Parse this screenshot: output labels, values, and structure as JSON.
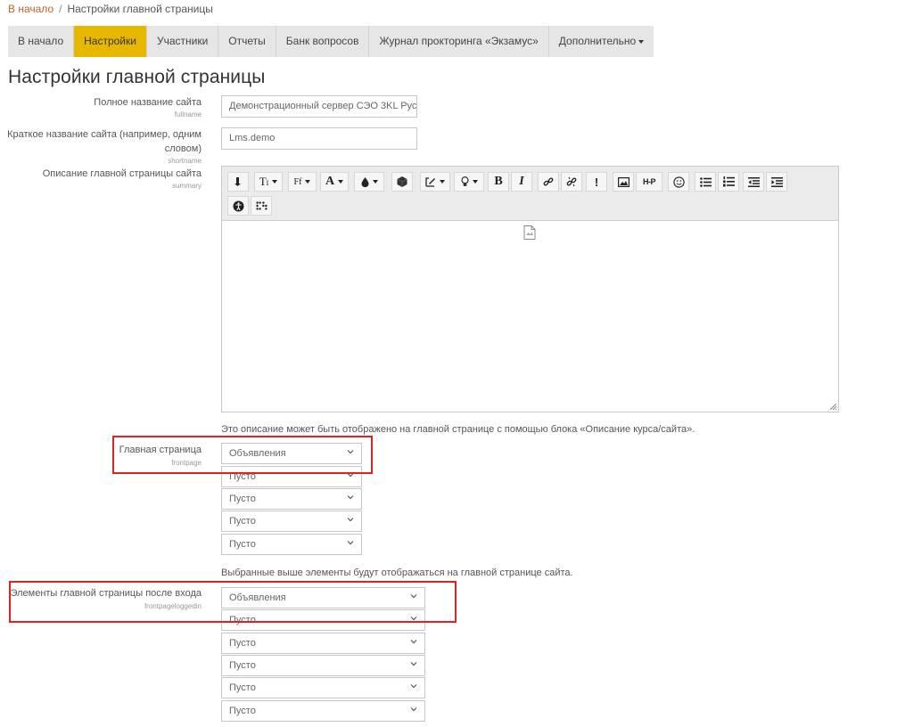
{
  "breadcrumb": {
    "home": "В начало",
    "separator": "/",
    "current": "Настройки главной страницы"
  },
  "tabs": [
    {
      "label": "В начало",
      "active": false
    },
    {
      "label": "Настройки",
      "active": true
    },
    {
      "label": "Участники",
      "active": false
    },
    {
      "label": "Отчеты",
      "active": false
    },
    {
      "label": "Банк вопросов",
      "active": false
    },
    {
      "label": "Журнал прокторинга «Экзамус»",
      "active": false
    },
    {
      "label": "Дополнительно",
      "active": false
    }
  ],
  "page_title": "Настройки главной страницы",
  "fullname": {
    "label": "Полное название сайта",
    "key": "fullname",
    "value": "Демонстрационный сервер СЭО 3KL Рус"
  },
  "shortname": {
    "label_line1": "Краткое название сайта (например, одним",
    "label_line2": "словом)",
    "key": "shortname",
    "value": "Lms.demo"
  },
  "summary": {
    "label": "Описание главной страницы сайта",
    "key": "summary",
    "help": "Это описание может быть отображено на главной странице с помощью блока «Описание курса/сайта»."
  },
  "editor_buttons": [
    "insert-icon",
    "text-style-icon",
    "font-family-icon",
    "font-color-icon",
    "fill-color-icon",
    "cube-icon",
    "draw-icon",
    "bulb-icon",
    "bold-icon",
    "italic-icon",
    "link-icon",
    "unlink-icon",
    "exclamation-icon",
    "image-icon",
    "h5p-icon",
    "emoticon-icon",
    "bullet-list-icon",
    "numbered-list-icon",
    "outdent-icon",
    "indent-icon",
    "accessibility-icon",
    "screenreader-icon"
  ],
  "toolbar_text": {
    "bold": "B",
    "italic": "I",
    "excl": "!",
    "h5p": "H-P",
    "font": "A",
    "font_family": "Ff"
  },
  "frontpage": {
    "label": "Главная страница",
    "key": "frontpage",
    "options": [
      "Объявления",
      "Пусто",
      "Пусто",
      "Пусто",
      "Пусто"
    ],
    "help": "Выбранные выше элементы будут отображаться на главной странице сайта."
  },
  "frontpageloggedin": {
    "label": "Элементы главной страницы после входа",
    "key": "frontpageloggedin",
    "options": [
      "Объявления",
      "Пусто",
      "Пусто",
      "Пусто",
      "Пусто",
      "Пусто"
    ]
  },
  "colors": {
    "accent": "#e8b800",
    "link": "#c0632e",
    "highlight": "#e0211f"
  }
}
